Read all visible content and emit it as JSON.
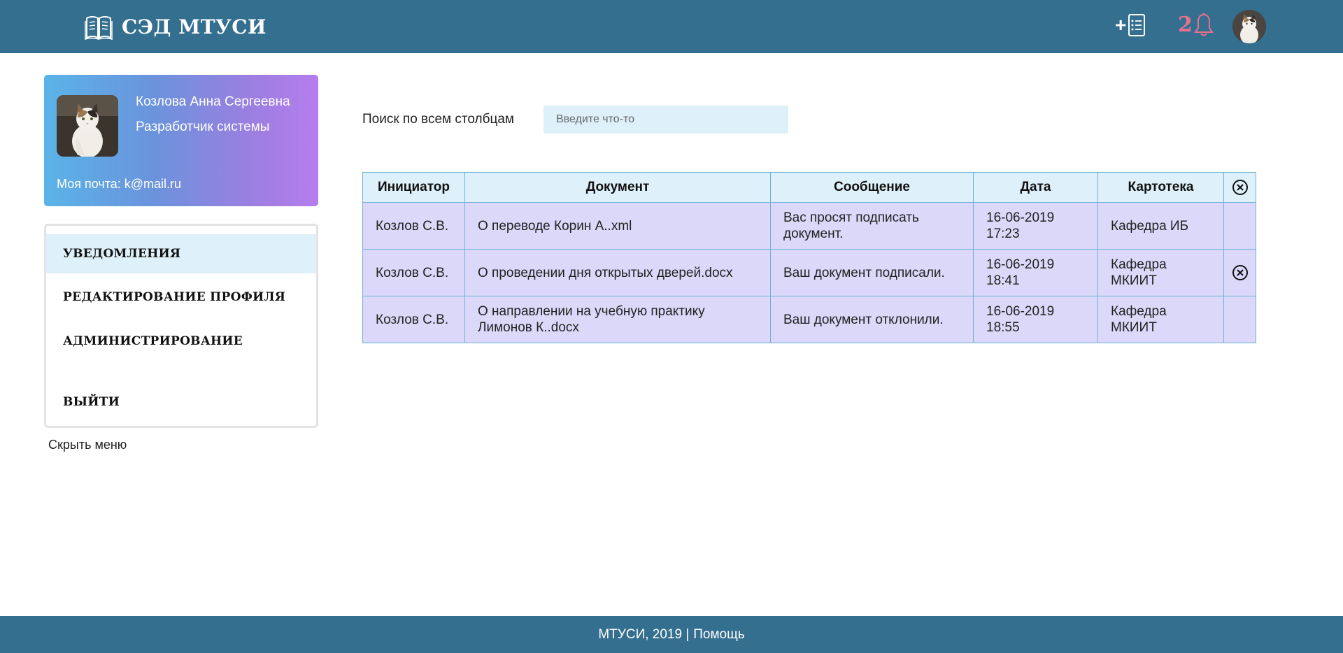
{
  "header": {
    "brand_title": "СЭД МТУСИ",
    "add_label": "+",
    "notification_count": "2"
  },
  "profile": {
    "name": "Козлова Анна Сергеевна",
    "role": "Разработчик системы",
    "email_line": "Моя почта: k@mail.ru"
  },
  "menu": {
    "items": [
      {
        "label": "УВЕДОМЛЕНИЯ",
        "active": true
      },
      {
        "label": "РЕДАКТИРОВАНИЕ ПРОФИЛЯ",
        "active": false
      },
      {
        "label": "АДМИНИСТРИРОВАНИЕ",
        "active": false
      },
      {
        "label": "ВЫЙТИ",
        "active": false
      }
    ],
    "hide_label": "Скрыть меню"
  },
  "search": {
    "label": "Поиск по всем столбцам",
    "placeholder": "Введите что-то",
    "value": ""
  },
  "table": {
    "headers": [
      "Инициатор",
      "Документ",
      "Сообщение",
      "Дата",
      "Картотека"
    ],
    "rows": [
      {
        "initiator": "Козлов С.В.",
        "document": "О переводе Корин А..xml",
        "message": "Вас просят подписать документ.",
        "date": "16-06-2019 17:23",
        "cabinet": "Кафедра ИБ",
        "has_close": false
      },
      {
        "initiator": "Козлов С.В.",
        "document": "О проведении дня открытых дверей.docx",
        "message": "Ваш документ подписали.",
        "date": "16-06-2019 18:41",
        "cabinet": "Кафедра МКИИТ",
        "has_close": true
      },
      {
        "initiator": "Козлов С.В.",
        "document": "О направлении на учебную практику Лимонов К..docx",
        "message": "Ваш документ отклонили.",
        "date": "16-06-2019 18:55",
        "cabinet": "Кафедра МКИИТ",
        "has_close": false
      }
    ]
  },
  "footer": {
    "copyright": "МТУСИ, 2019 |",
    "help_link": "Помощь"
  },
  "icons": {
    "brand": "book-icon",
    "add": "new-document-icon",
    "notifications": "bell-icon",
    "clear_all": "close-circle-icon"
  },
  "colors": {
    "header_bg": "#346f8f",
    "accent_light": "#def0f9",
    "row_bg": "#dbd8f9",
    "notification_badge": "#ec6f8f"
  }
}
